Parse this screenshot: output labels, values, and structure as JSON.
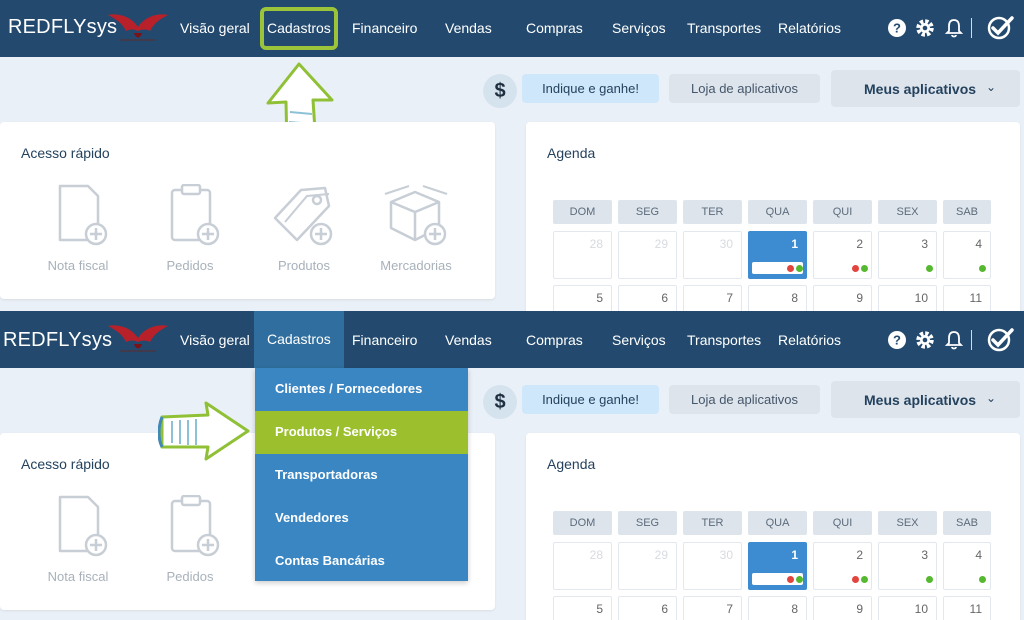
{
  "app": {
    "brand": "REDFLYsys"
  },
  "nav": {
    "items": [
      "Visão geral",
      "Cadastros",
      "Financeiro",
      "Vendas",
      "Compras",
      "Serviços",
      "Transportes",
      "Relatórios"
    ],
    "icons": [
      "help-icon",
      "gear-icon",
      "bell-icon",
      "check-logo-icon"
    ]
  },
  "toolbar": {
    "dollar": "$",
    "indique": "Indique e ganhe!",
    "loja": "Loja de aplicativos",
    "meus": "Meus aplicativos"
  },
  "quick_access": {
    "title": "Acesso rápido",
    "items": [
      "Nota fiscal",
      "Pedidos",
      "Produtos",
      "Mercadorias"
    ]
  },
  "agenda": {
    "title": "Agenda",
    "weekdays": [
      "DOM",
      "SEG",
      "TER",
      "QUA",
      "QUI",
      "SEX",
      "SAB"
    ],
    "week1": [
      "28",
      "29",
      "30",
      "1",
      "2",
      "3",
      "4"
    ],
    "week2": [
      "5",
      "6",
      "7",
      "8",
      "9",
      "10",
      "11"
    ]
  },
  "dropdown": {
    "items": [
      "Clientes / Fornecedores",
      "Produtos / Serviços",
      "Transportadoras",
      "Vendedores",
      "Contas Bancárias"
    ],
    "active_index": 1
  },
  "colors": {
    "navbar": "#234a6e",
    "highlight": "#9bc43b",
    "dropdown": "#3a86c3",
    "dropdown_active": "#9cc02d",
    "today": "#3d8bd0"
  }
}
